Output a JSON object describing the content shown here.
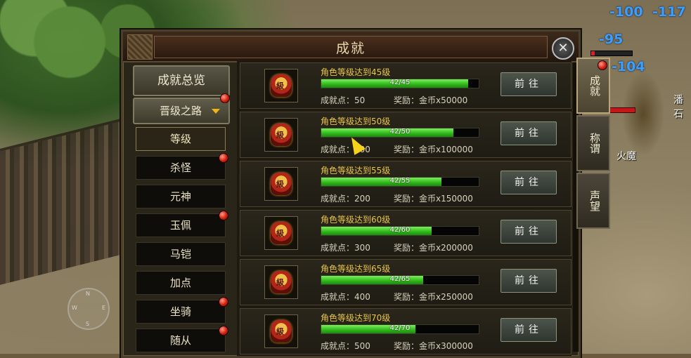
{
  "hud": {
    "numbers": [
      "-100",
      "-117",
      "-95",
      "-104"
    ],
    "npc_names": [
      "潘石",
      "火魔"
    ]
  },
  "compass": {
    "n": "N",
    "e": "E",
    "s": "S",
    "w": "W"
  },
  "panel": {
    "title": "成就",
    "close_label": "✕"
  },
  "sidebar": {
    "overview_label": "成就总览",
    "dropdown_label": "晋级之路",
    "items": [
      {
        "label": "等级",
        "active": true,
        "dot": false
      },
      {
        "label": "杀怪",
        "active": false,
        "dot": true
      },
      {
        "label": "元神",
        "active": false,
        "dot": false
      },
      {
        "label": "玉佩",
        "active": false,
        "dot": true
      },
      {
        "label": "马铠",
        "active": false,
        "dot": false
      },
      {
        "label": "加点",
        "active": false,
        "dot": false
      },
      {
        "label": "坐骑",
        "active": false,
        "dot": true
      },
      {
        "label": "随从",
        "active": false,
        "dot": true
      }
    ]
  },
  "achievements": [
    {
      "name": "角色等级达到45级",
      "progress_text": "42/45",
      "progress": 0.933,
      "points": "成就点：50",
      "reward": "奖励：金币x50000",
      "button": "前往"
    },
    {
      "name": "角色等级达到50级",
      "progress_text": "42/50",
      "progress": 0.84,
      "points": "成就点：100",
      "reward": "奖励：金币x100000",
      "button": "前往"
    },
    {
      "name": "角色等级达到55级",
      "progress_text": "42/55",
      "progress": 0.764,
      "points": "成就点：200",
      "reward": "奖励：金币x150000",
      "button": "前往"
    },
    {
      "name": "角色等级达到60级",
      "progress_text": "42/60",
      "progress": 0.7,
      "points": "成就点：300",
      "reward": "奖励：金币x200000",
      "button": "前往"
    },
    {
      "name": "角色等级达到65级",
      "progress_text": "42/65",
      "progress": 0.646,
      "points": "成就点：400",
      "reward": "奖励：金币x250000",
      "button": "前往"
    },
    {
      "name": "角色等级达到70级",
      "progress_text": "42/70",
      "progress": 0.6,
      "points": "成就点：500",
      "reward": "奖励：金币x300000",
      "button": "前往"
    }
  ],
  "right_tabs": [
    {
      "label": "成就",
      "active": true
    },
    {
      "label": "称谓",
      "active": false
    },
    {
      "label": "声望",
      "active": false
    }
  ]
}
